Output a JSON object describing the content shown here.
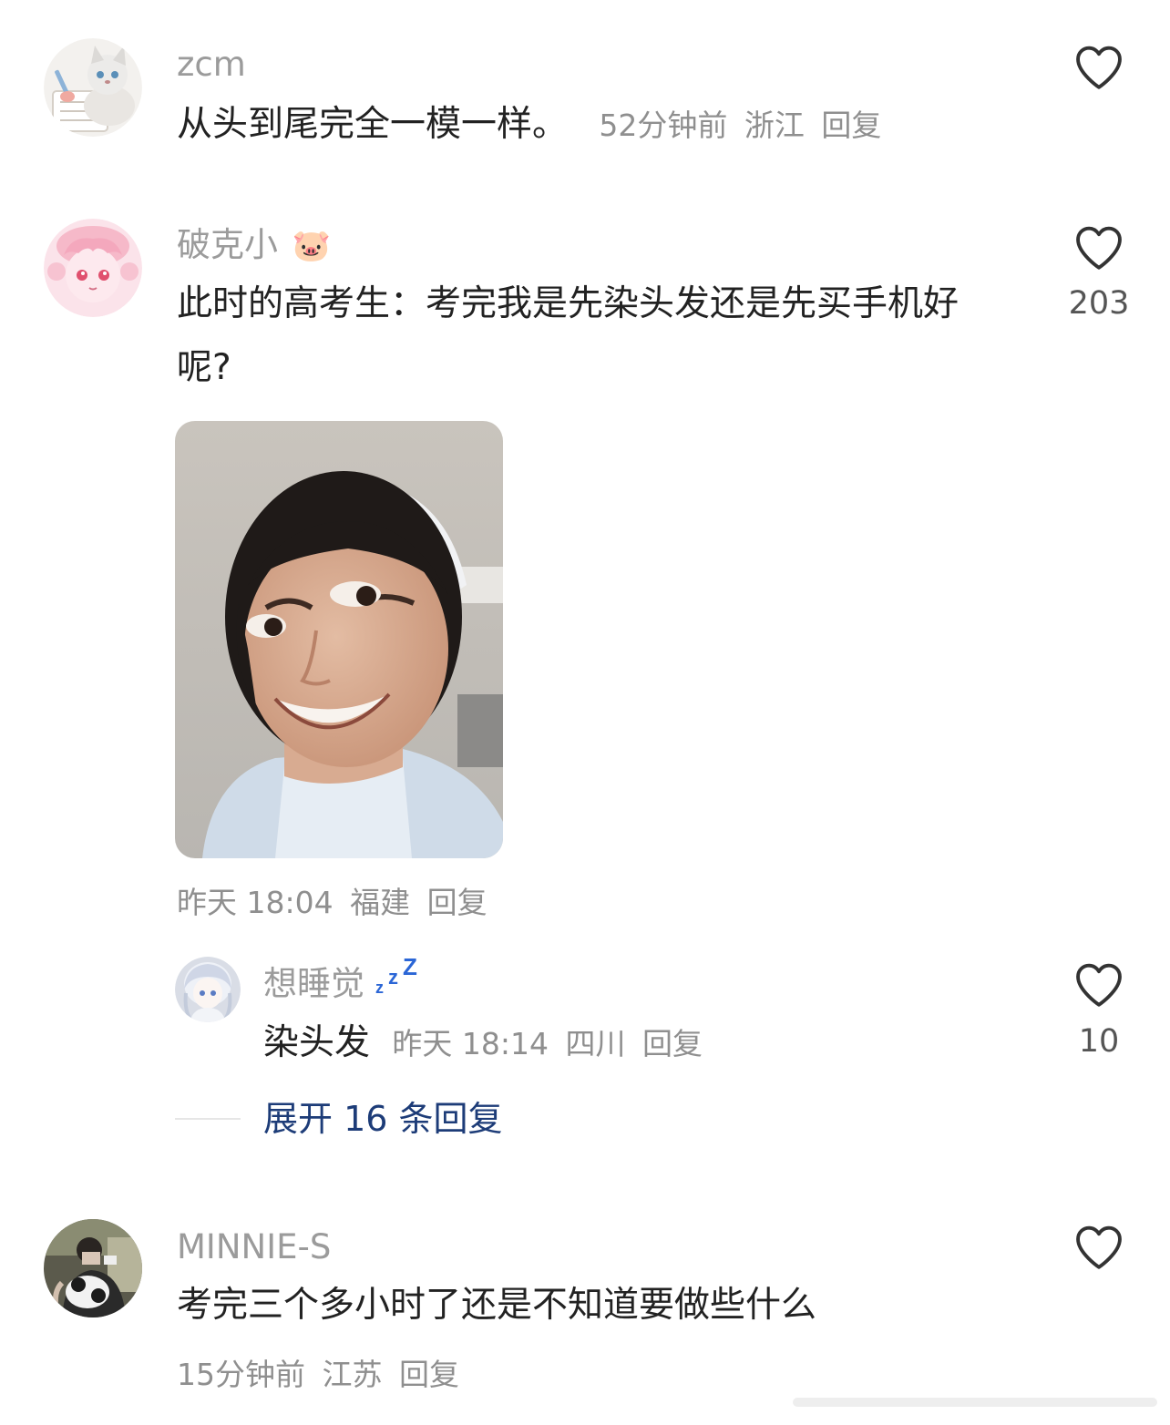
{
  "comments": [
    {
      "username": "zcm",
      "text": "从头到尾完全一模一样。",
      "time": "52分钟前",
      "location": "浙江",
      "reply_label": "回复",
      "likes": "",
      "avatar_icon": "cat-avatar-icon"
    },
    {
      "username": "破克小",
      "username_emoji": "🐷",
      "text_line1": "此时的高考生：考完我是先染头发还是先买手机好",
      "text_line2": "呢?",
      "time": "昨天 18:04",
      "location": "福建",
      "reply_label": "回复",
      "likes": "203",
      "avatar_icon": "anime-girl-avatar-icon",
      "image_icon": "nurse-meme-photo"
    },
    {
      "username": "MINNIE-S",
      "text": "考完三个多小时了还是不知道要做些什么",
      "time": "15分钟前",
      "location": "江苏",
      "reply_label": "回复",
      "likes": "",
      "avatar_icon": "photo-avatar-icon"
    }
  ],
  "reply": {
    "username": "想睡觉",
    "username_emoji": "zzz",
    "text": "染头发",
    "time": "昨天 18:14",
    "location": "四川",
    "reply_label": "回复",
    "likes": "10",
    "avatar_icon": "anime-avatar-icon"
  },
  "expand_label": "展开 16 条回复",
  "colors": {
    "username": "#9b9b9b",
    "text": "#222222",
    "meta": "#8f8f8f",
    "expand": "#1d3c78",
    "like_icon": "#333333"
  }
}
